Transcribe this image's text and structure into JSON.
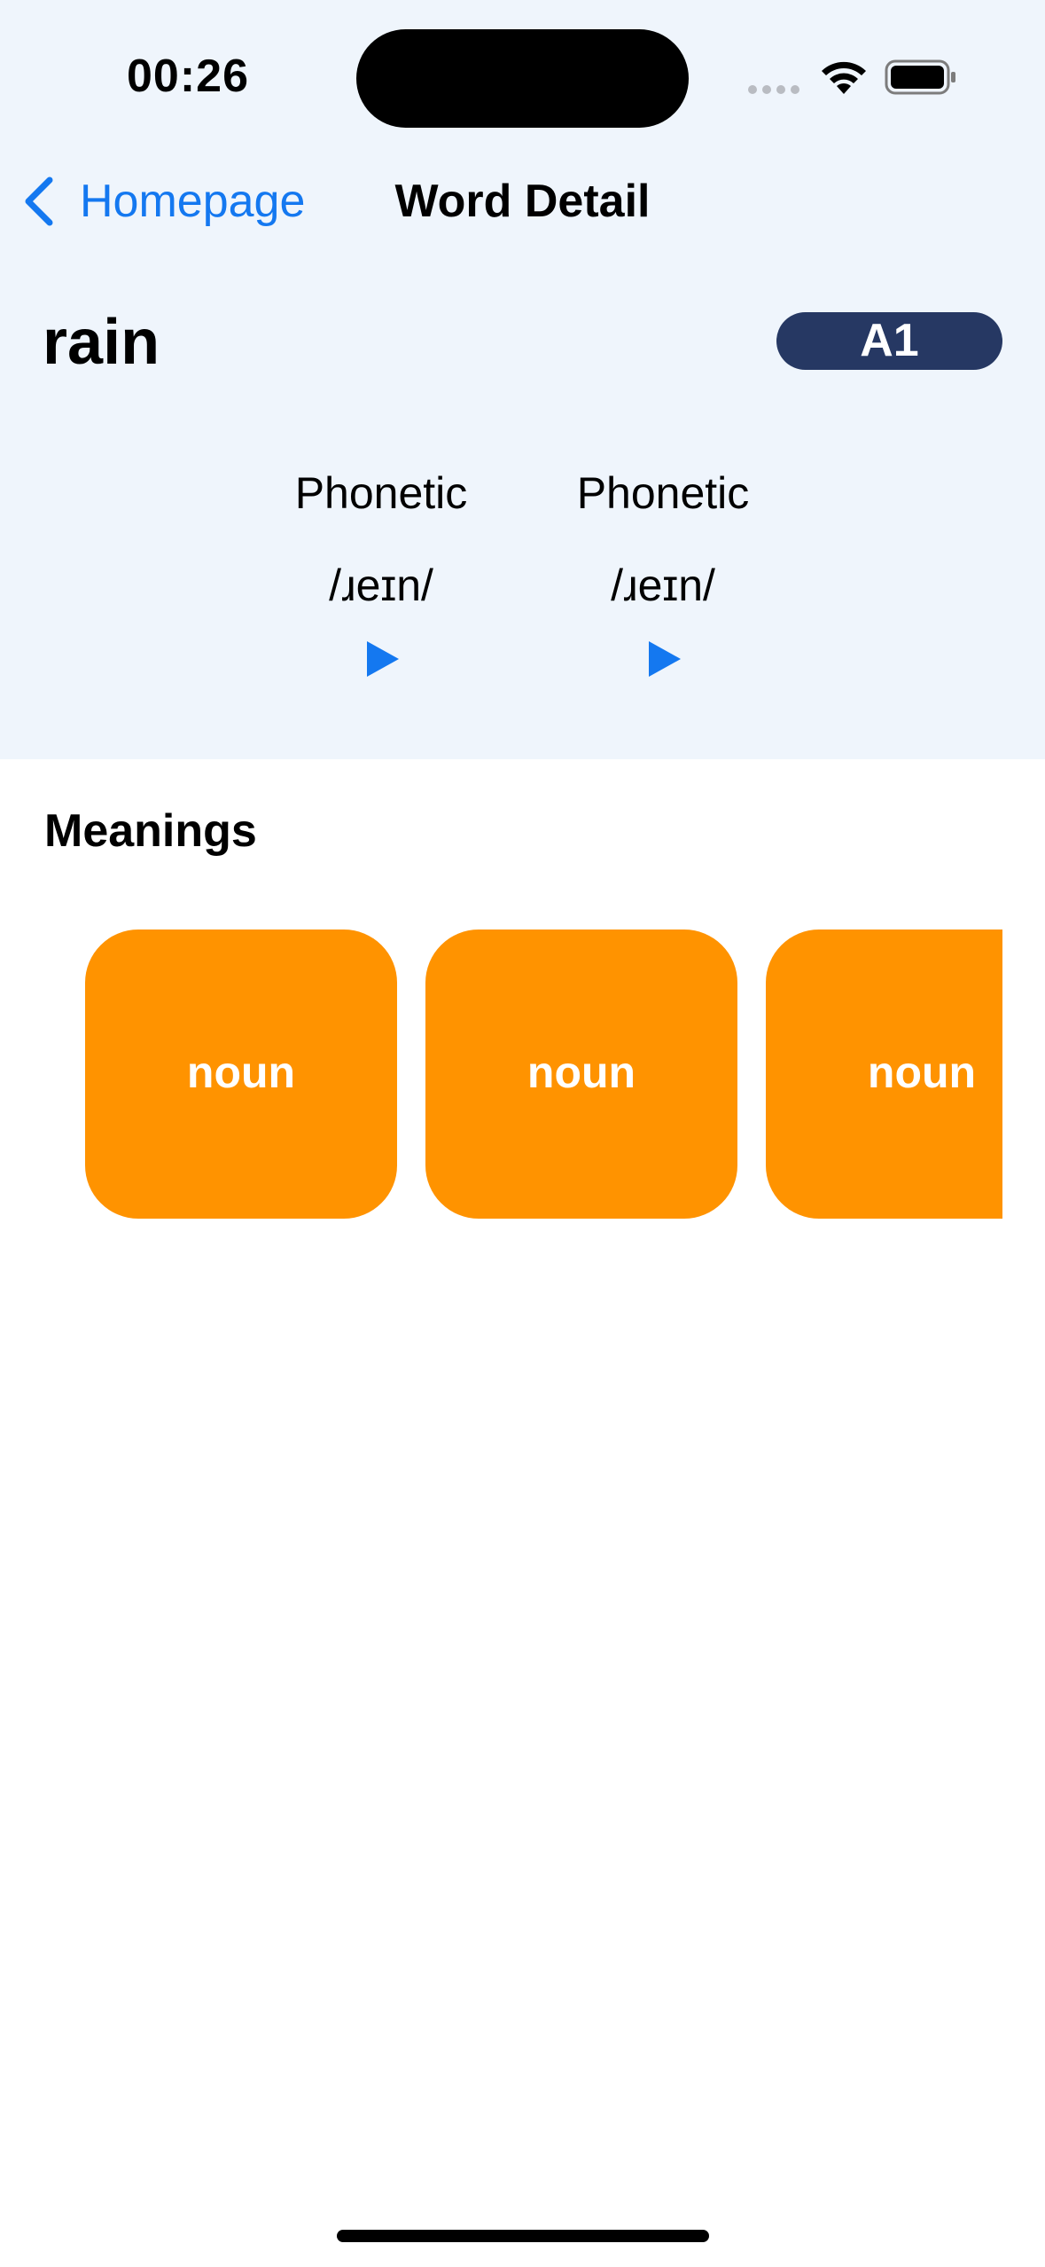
{
  "status_bar": {
    "time": "00:26"
  },
  "nav": {
    "back_label": "Homepage",
    "title": "Word Detail",
    "accent_color": "#1478f0"
  },
  "word": {
    "text": "rain",
    "level": "A1"
  },
  "phonetics": [
    {
      "label": "Phonetic",
      "ipa": "/ɹeɪn/",
      "play_icon": "play-icon"
    },
    {
      "label": "Phonetic",
      "ipa": "/ɹeɪn/",
      "play_icon": "play-icon"
    }
  ],
  "meanings": {
    "title": "Meanings",
    "cards": [
      {
        "part_of_speech": "noun"
      },
      {
        "part_of_speech": "noun"
      },
      {
        "part_of_speech": "noun"
      }
    ],
    "card_color": "#ff9300"
  },
  "colors": {
    "header_background": "#eff5fc",
    "badge_background": "#263863"
  }
}
